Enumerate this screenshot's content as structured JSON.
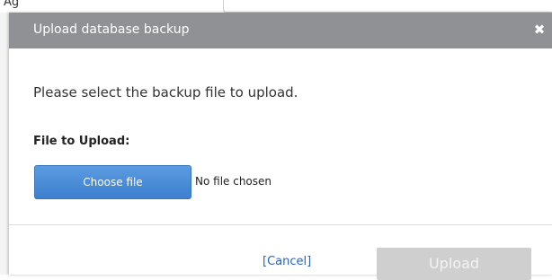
{
  "background": {
    "partial_text": "Ag"
  },
  "dialog": {
    "title": "Upload database backup",
    "close_glyph": "✖",
    "intro": "Please select the backup file to upload.",
    "file_label": "File to Upload:",
    "choose_button": "Choose file",
    "no_file_text": "No file chosen",
    "cancel_link": "[Cancel]",
    "upload_button": "Upload"
  },
  "colors": {
    "titlebar": "#8f9194",
    "choose_button": "#3d7fcf",
    "cancel_link": "#2a63b8",
    "upload_disabled": "#cfcfcf"
  },
  "icons": {
    "close": "close-icon"
  }
}
